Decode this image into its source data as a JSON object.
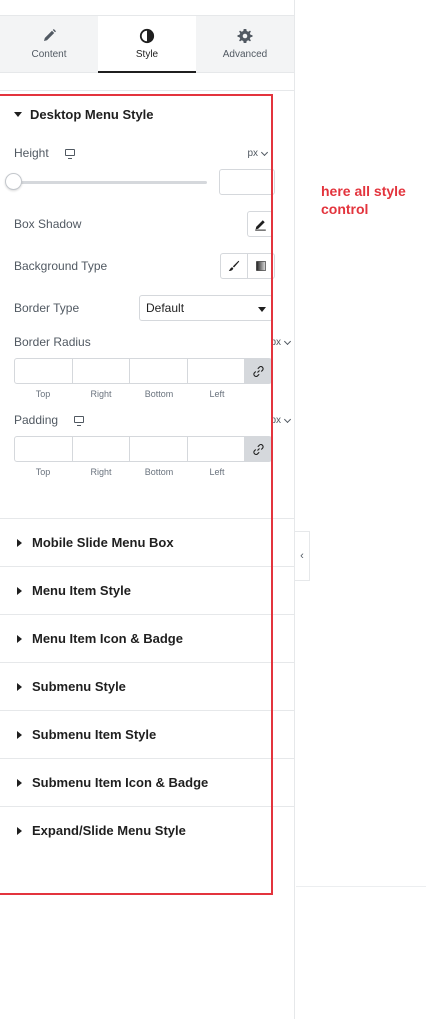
{
  "tabs": [
    {
      "label": "Content",
      "icon": "pencil-icon"
    },
    {
      "label": "Style",
      "icon": "contrast-icon"
    },
    {
      "label": "Advanced",
      "icon": "gear-icon"
    }
  ],
  "active_tab": "Style",
  "section_open": {
    "title": "Desktop Menu Style",
    "height": {
      "label": "Height",
      "unit": "px"
    },
    "box_shadow": {
      "label": "Box Shadow"
    },
    "background_type": {
      "label": "Background Type"
    },
    "border_type": {
      "label": "Border Type",
      "value": "Default"
    },
    "border_radius": {
      "label": "Border Radius",
      "unit": "px",
      "sides": [
        "Top",
        "Right",
        "Bottom",
        "Left"
      ]
    },
    "padding": {
      "label": "Padding",
      "unit": "px",
      "sides": [
        "Top",
        "Right",
        "Bottom",
        "Left"
      ]
    }
  },
  "sections_collapsed": [
    "Mobile Slide Menu Box",
    "Menu Item Style",
    "Menu Item Icon & Badge",
    "Submenu Style",
    "Submenu Item Style",
    "Submenu Item Icon & Badge",
    "Expand/Slide Menu Style"
  ],
  "annotation": "here all style control",
  "colors": {
    "highlight": "#e3343d",
    "accent": "#1f1f1f"
  }
}
